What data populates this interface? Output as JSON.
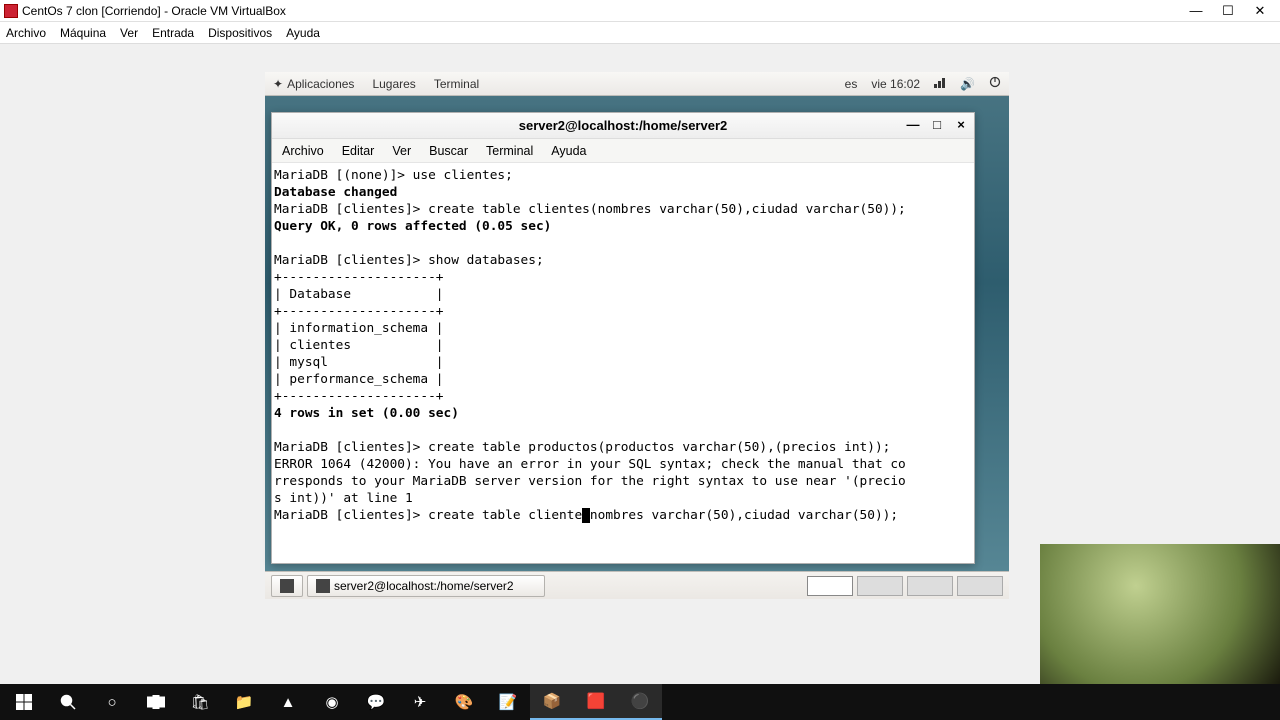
{
  "host": {
    "title": "CentOs 7  clon [Corriendo] - Oracle VM VirtualBox",
    "menu": [
      "Archivo",
      "Máquina",
      "Ver",
      "Entrada",
      "Dispositivos",
      "Ayuda"
    ]
  },
  "gnome": {
    "topbar": {
      "apps": "Aplicaciones",
      "places": "Lugares",
      "term": "Terminal",
      "lang": "es",
      "clock": "vie 16:02"
    },
    "task_title": "server2@localhost:/home/server2"
  },
  "terminal": {
    "title": "server2@localhost:/home/server2",
    "menu": [
      "Archivo",
      "Editar",
      "Ver",
      "Buscar",
      "Terminal",
      "Ayuda"
    ],
    "lines": {
      "l0": "MariaDB [(none)]> use clientes;",
      "l1": "Database changed",
      "l2": "MariaDB [clientes]> create table clientes(nombres varchar(50),ciudad varchar(50));",
      "l3": "Query OK, 0 rows affected (0.05 sec)",
      "l4": "",
      "l5": "MariaDB [clientes]> show databases;",
      "l6": "+--------------------+",
      "l7": "| Database           |",
      "l8": "+--------------------+",
      "l9": "| information_schema |",
      "l10": "| clientes           |",
      "l11": "| mysql              |",
      "l12": "| performance_schema |",
      "l13": "+--------------------+",
      "l14": "4 rows in set (0.00 sec)",
      "l15": "",
      "l16": "MariaDB [clientes]> create table productos(productos varchar(50),(precios int));",
      "l17": "ERROR 1064 (42000): You have an error in your SQL syntax; check the manual that co",
      "l18": "rresponds to your MariaDB server version for the right syntax to use near '(precio",
      "l19": "s int))' at line 1",
      "l20a": "MariaDB [clientes]> create table cliente",
      "l20b": "(",
      "l20c": "nombres varchar(50),ciudad varchar(50));"
    }
  }
}
